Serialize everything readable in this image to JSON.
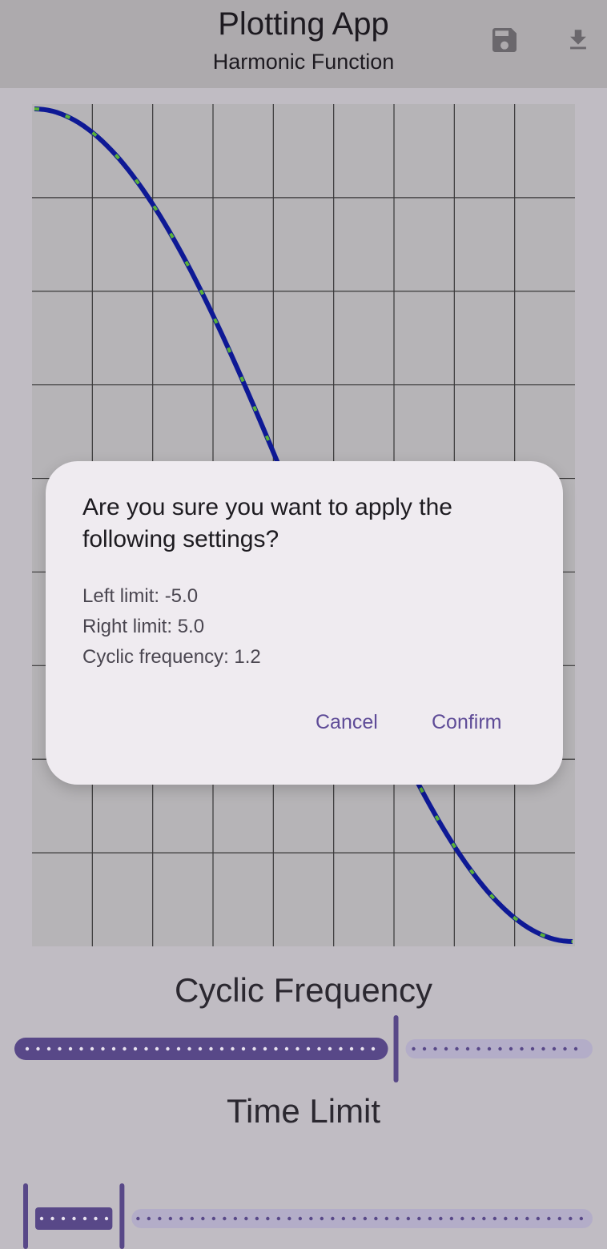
{
  "appbar": {
    "title": "Plotting App",
    "subtitle": "Harmonic Function",
    "save_icon": "save-icon",
    "download_icon": "download-icon"
  },
  "dialog": {
    "headline": "Are you sure you want to apply the following settings?",
    "lines": [
      "Left limit: -5.0",
      "Right limit: 5.0",
      "Cyclic frequency: 1.2"
    ],
    "cancel_label": "Cancel",
    "confirm_label": "Confirm"
  },
  "sliders": {
    "cyclic_frequency": {
      "label": "Cyclic Frequency",
      "fraction": 0.66
    },
    "time_limit": {
      "label": "Time Limit",
      "range_fraction": [
        0.0,
        0.17
      ]
    }
  },
  "colors": {
    "curve_blue": "#0d1a9a",
    "curve_green": "#5cb83a",
    "accent": "#5a4a8c",
    "track_inactive": "#b9b4cf"
  }
}
